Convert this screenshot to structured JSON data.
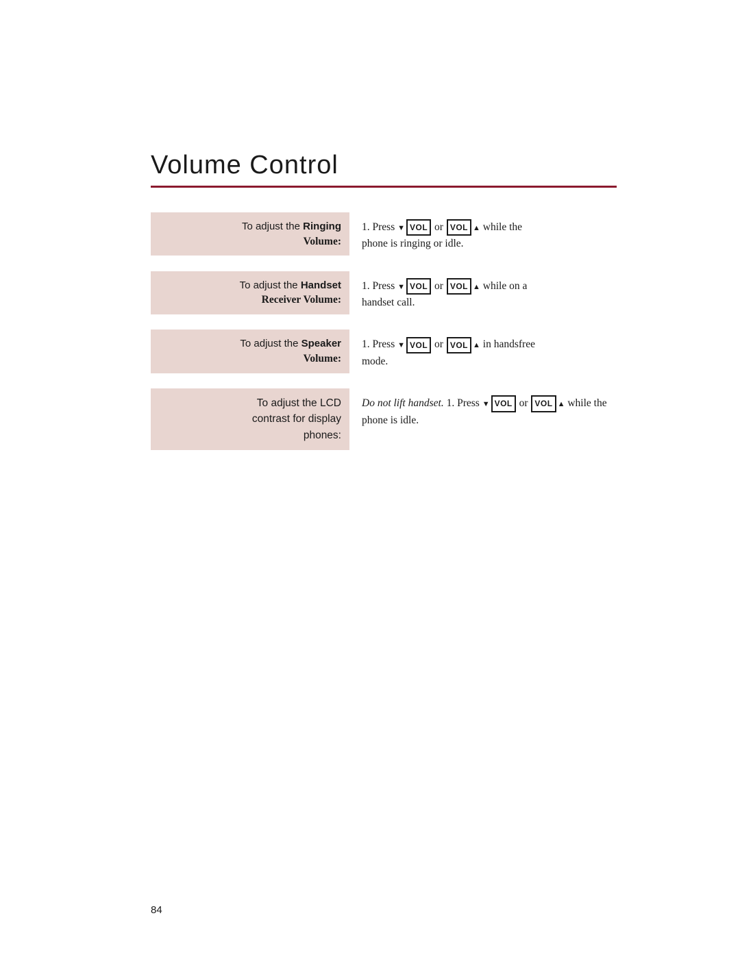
{
  "page": {
    "title": "Volume Control",
    "page_number": "84",
    "accent_color": "#8b1a2e",
    "label_bg": "#e8d5d0"
  },
  "rows": [
    {
      "id": "ringing",
      "label_line1": "To adjust the Ringing",
      "label_line2": "Volume:",
      "label_bold": "Volume:",
      "step_prefix": "1. Press",
      "vol_label": "VOL",
      "connector": "or",
      "suffix": "while the",
      "line2": "phone is ringing or idle."
    },
    {
      "id": "handset",
      "label_line1": "To adjust the Handset",
      "label_line2": "Receiver Volume:",
      "label_bold": "Receiver Volume:",
      "step_prefix": "1. Press",
      "vol_label": "VOL",
      "connector": "or",
      "suffix": "while on a",
      "line2": "handset call."
    },
    {
      "id": "speaker",
      "label_line1": "To adjust the Speaker",
      "label_line2": "Volume:",
      "label_bold": "Volume:",
      "step_prefix": "1. Press",
      "vol_label": "VOL",
      "connector": "or",
      "suffix": "in handsfree",
      "line2": "mode."
    },
    {
      "id": "lcd",
      "label_line1": "To adjust the LCD",
      "label_line2": "contrast for display",
      "label_line3": "phones:",
      "label_bold": "phones:",
      "italic_note": "Do not lift handset.",
      "step_prefix": "1. Press",
      "vol_label": "VOL",
      "connector": "or",
      "suffix": "while the",
      "line2": "phone is idle."
    }
  ],
  "buttons": {
    "vol_down_arrow": "▼",
    "vol_up_arrow": "▲",
    "vol_text": "VOL"
  }
}
